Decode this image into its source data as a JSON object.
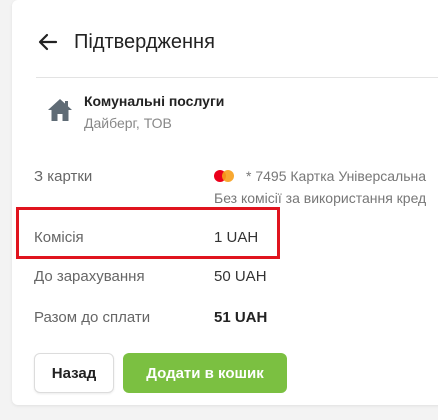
{
  "header": {
    "title": "Підтвердження"
  },
  "service": {
    "name": "Комунальні послуги",
    "provider": "Дайберг, ТОВ"
  },
  "payment": {
    "from_card_label": "З картки",
    "card_text": "* 7495 Картка Універсальна",
    "card_note": "Без комісії за використання кред",
    "commission_label": "Комісія",
    "commission_value": "1 UAH",
    "credit_label": "До зарахування",
    "credit_value": "50 UAH",
    "total_label": "Разом до сплати",
    "total_value": "51 UAH"
  },
  "buttons": {
    "back_label": "Назад",
    "add_label": "Додати в кошик"
  },
  "colors": {
    "accent_green": "#7bc041",
    "highlight_red": "#e0141e",
    "icon_gray": "#5f6b75"
  },
  "icons": {
    "back": "arrow-left-icon",
    "service": "house-icon",
    "card": "mastercard-icon"
  }
}
